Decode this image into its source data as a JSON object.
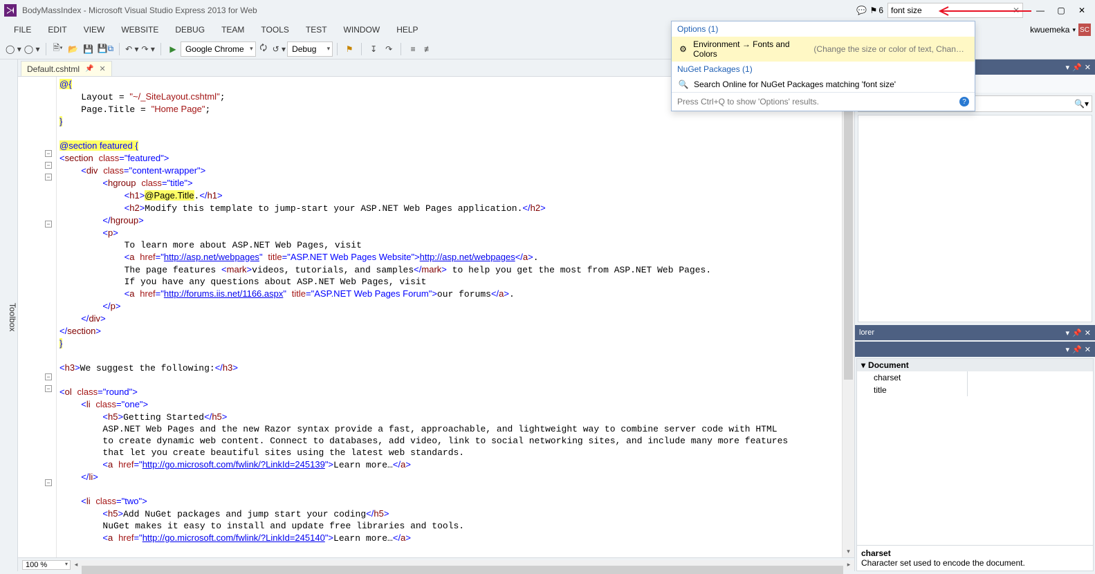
{
  "titlebar": {
    "title": "BodyMassIndex - Microsoft Visual Studio Express 2013 for Web",
    "notif_count": "6",
    "quick_launch_value": "font size"
  },
  "menubar": {
    "items": [
      "FILE",
      "EDIT",
      "VIEW",
      "WEBSITE",
      "DEBUG",
      "TEAM",
      "TOOLS",
      "TEST",
      "WINDOW",
      "HELP"
    ],
    "user_name": "kwuemeka",
    "user_initials": "SC"
  },
  "toolbar": {
    "browser": "Google Chrome",
    "config": "Debug"
  },
  "tab": {
    "name": "Default.cshtml"
  },
  "code_lines": [
    {
      "indent": 0,
      "hl": true,
      "segs": [
        {
          "c": "c-blue",
          "t": "@{"
        }
      ]
    },
    {
      "indent": 1,
      "segs": [
        {
          "t": "Layout = "
        },
        {
          "c": "c-red",
          "t": "\"~/_SiteLayout.cshtml\""
        },
        {
          "t": ";"
        }
      ]
    },
    {
      "indent": 1,
      "segs": [
        {
          "t": "Page.Title = "
        },
        {
          "c": "c-red",
          "t": "\"Home Page\""
        },
        {
          "t": ";"
        }
      ]
    },
    {
      "indent": 0,
      "hl": true,
      "segs": [
        {
          "c": "c-blue",
          "t": "}"
        }
      ]
    },
    {
      "blank": true
    },
    {
      "indent": 0,
      "hl": true,
      "segs": [
        {
          "c": "c-blue",
          "t": "@section featured {"
        }
      ]
    },
    {
      "indent": 0,
      "segs": [
        {
          "c": "c-blue",
          "t": "<"
        },
        {
          "c": "c-maroon",
          "t": "section"
        },
        {
          "t": " "
        },
        {
          "c": "c-red",
          "t": "class"
        },
        {
          "c": "c-blue",
          "t": "=\"featured\">"
        }
      ]
    },
    {
      "indent": 1,
      "segs": [
        {
          "c": "c-blue",
          "t": "<"
        },
        {
          "c": "c-maroon",
          "t": "div"
        },
        {
          "t": " "
        },
        {
          "c": "c-red",
          "t": "class"
        },
        {
          "c": "c-blue",
          "t": "=\"content-wrapper\">"
        }
      ]
    },
    {
      "indent": 2,
      "segs": [
        {
          "c": "c-blue",
          "t": "<"
        },
        {
          "c": "c-maroon",
          "t": "hgroup"
        },
        {
          "t": " "
        },
        {
          "c": "c-red",
          "t": "class"
        },
        {
          "c": "c-blue",
          "t": "=\"title\">"
        }
      ]
    },
    {
      "indent": 3,
      "segs": [
        {
          "c": "c-blue",
          "t": "<"
        },
        {
          "c": "c-maroon",
          "t": "h1"
        },
        {
          "c": "c-blue",
          "t": ">"
        },
        {
          "hl": true,
          "t": "@Page.Title"
        },
        {
          "t": "."
        },
        {
          "c": "c-blue",
          "t": "</"
        },
        {
          "c": "c-maroon",
          "t": "h1"
        },
        {
          "c": "c-blue",
          "t": ">"
        }
      ]
    },
    {
      "indent": 3,
      "segs": [
        {
          "c": "c-blue",
          "t": "<"
        },
        {
          "c": "c-maroon",
          "t": "h2"
        },
        {
          "c": "c-blue",
          "t": ">"
        },
        {
          "t": "Modify this template to jump-start your ASP.NET Web Pages application."
        },
        {
          "c": "c-blue",
          "t": "</"
        },
        {
          "c": "c-maroon",
          "t": "h2"
        },
        {
          "c": "c-blue",
          "t": ">"
        }
      ]
    },
    {
      "indent": 2,
      "segs": [
        {
          "c": "c-blue",
          "t": "</"
        },
        {
          "c": "c-maroon",
          "t": "hgroup"
        },
        {
          "c": "c-blue",
          "t": ">"
        }
      ]
    },
    {
      "indent": 2,
      "segs": [
        {
          "c": "c-blue",
          "t": "<"
        },
        {
          "c": "c-maroon",
          "t": "p"
        },
        {
          "c": "c-blue",
          "t": ">"
        }
      ]
    },
    {
      "indent": 3,
      "segs": [
        {
          "t": "To learn more about ASP.NET Web Pages, visit"
        }
      ]
    },
    {
      "indent": 3,
      "segs": [
        {
          "c": "c-blue",
          "t": "<"
        },
        {
          "c": "c-maroon",
          "t": "a"
        },
        {
          "t": " "
        },
        {
          "c": "c-red",
          "t": "href"
        },
        {
          "c": "c-blue",
          "t": "=\""
        },
        {
          "c": "c-link",
          "t": "http://asp.net/webpages"
        },
        {
          "c": "c-blue",
          "t": "\""
        },
        {
          "t": " "
        },
        {
          "c": "c-red",
          "t": "title"
        },
        {
          "c": "c-blue",
          "t": "=\"ASP.NET Web Pages Website\">"
        },
        {
          "c": "c-link",
          "t": "http://asp.net/webpages"
        },
        {
          "c": "c-blue",
          "t": "</"
        },
        {
          "c": "c-maroon",
          "t": "a"
        },
        {
          "c": "c-blue",
          "t": ">"
        },
        {
          "t": "."
        }
      ]
    },
    {
      "indent": 3,
      "segs": [
        {
          "t": "The page features "
        },
        {
          "c": "c-blue",
          "t": "<"
        },
        {
          "c": "c-maroon",
          "t": "mark"
        },
        {
          "c": "c-blue",
          "t": ">"
        },
        {
          "t": "videos, tutorials, and samples"
        },
        {
          "c": "c-blue",
          "t": "</"
        },
        {
          "c": "c-maroon",
          "t": "mark"
        },
        {
          "c": "c-blue",
          "t": ">"
        },
        {
          "t": " to help you get the most from ASP.NET Web Pages."
        }
      ]
    },
    {
      "indent": 3,
      "segs": [
        {
          "t": "If you have any questions about ASP.NET Web Pages, visit"
        }
      ]
    },
    {
      "indent": 3,
      "segs": [
        {
          "c": "c-blue",
          "t": "<"
        },
        {
          "c": "c-maroon",
          "t": "a"
        },
        {
          "t": " "
        },
        {
          "c": "c-red",
          "t": "href"
        },
        {
          "c": "c-blue",
          "t": "=\""
        },
        {
          "c": "c-link",
          "t": "http://forums.iis.net/1166.aspx"
        },
        {
          "c": "c-blue",
          "t": "\""
        },
        {
          "t": " "
        },
        {
          "c": "c-red",
          "t": "title"
        },
        {
          "c": "c-blue",
          "t": "=\"ASP.NET Web Pages Forum\">"
        },
        {
          "t": "our forums"
        },
        {
          "c": "c-blue",
          "t": "</"
        },
        {
          "c": "c-maroon",
          "t": "a"
        },
        {
          "c": "c-blue",
          "t": ">"
        },
        {
          "t": "."
        }
      ]
    },
    {
      "indent": 2,
      "segs": [
        {
          "c": "c-blue",
          "t": "</"
        },
        {
          "c": "c-maroon",
          "t": "p"
        },
        {
          "c": "c-blue",
          "t": ">"
        }
      ]
    },
    {
      "indent": 1,
      "segs": [
        {
          "c": "c-blue",
          "t": "</"
        },
        {
          "c": "c-maroon",
          "t": "div"
        },
        {
          "c": "c-blue",
          "t": ">"
        }
      ]
    },
    {
      "indent": 0,
      "segs": [
        {
          "c": "c-blue",
          "t": "</"
        },
        {
          "c": "c-maroon",
          "t": "section"
        },
        {
          "c": "c-blue",
          "t": ">"
        }
      ]
    },
    {
      "indent": 0,
      "hl": true,
      "segs": [
        {
          "c": "c-blue",
          "t": "}"
        }
      ]
    },
    {
      "blank": true
    },
    {
      "indent": 0,
      "segs": [
        {
          "c": "c-blue",
          "t": "<"
        },
        {
          "c": "c-maroon",
          "t": "h3"
        },
        {
          "c": "c-blue",
          "t": ">"
        },
        {
          "t": "We suggest the following:"
        },
        {
          "c": "c-blue",
          "t": "</"
        },
        {
          "c": "c-maroon",
          "t": "h3"
        },
        {
          "c": "c-blue",
          "t": ">"
        }
      ]
    },
    {
      "blank": true
    },
    {
      "indent": 0,
      "segs": [
        {
          "c": "c-blue",
          "t": "<"
        },
        {
          "c": "c-maroon",
          "t": "ol"
        },
        {
          "t": " "
        },
        {
          "c": "c-red",
          "t": "class"
        },
        {
          "c": "c-blue",
          "t": "=\"round\">"
        }
      ]
    },
    {
      "indent": 1,
      "segs": [
        {
          "c": "c-blue",
          "t": "<"
        },
        {
          "c": "c-maroon",
          "t": "li"
        },
        {
          "t": " "
        },
        {
          "c": "c-red",
          "t": "class"
        },
        {
          "c": "c-blue",
          "t": "=\"one\">"
        }
      ]
    },
    {
      "indent": 2,
      "segs": [
        {
          "c": "c-blue",
          "t": "<"
        },
        {
          "c": "c-maroon",
          "t": "h5"
        },
        {
          "c": "c-blue",
          "t": ">"
        },
        {
          "t": "Getting Started"
        },
        {
          "c": "c-blue",
          "t": "</"
        },
        {
          "c": "c-maroon",
          "t": "h5"
        },
        {
          "c": "c-blue",
          "t": ">"
        }
      ]
    },
    {
      "indent": 2,
      "segs": [
        {
          "t": "ASP.NET Web Pages and the new Razor syntax provide a fast, approachable, and lightweight way to combine server code with HTML"
        }
      ]
    },
    {
      "indent": 2,
      "segs": [
        {
          "t": "to create dynamic web content. Connect to databases, add video, link to social networking sites, and include many more features"
        }
      ]
    },
    {
      "indent": 2,
      "segs": [
        {
          "t": "that let you create beautiful sites using the latest web standards."
        }
      ]
    },
    {
      "indent": 2,
      "segs": [
        {
          "c": "c-blue",
          "t": "<"
        },
        {
          "c": "c-maroon",
          "t": "a"
        },
        {
          "t": " "
        },
        {
          "c": "c-red",
          "t": "href"
        },
        {
          "c": "c-blue",
          "t": "=\""
        },
        {
          "c": "c-link",
          "t": "http://go.microsoft.com/fwlink/?LinkId=245139"
        },
        {
          "c": "c-blue",
          "t": "\">"
        },
        {
          "t": "Learn more…"
        },
        {
          "c": "c-blue",
          "t": "</"
        },
        {
          "c": "c-maroon",
          "t": "a"
        },
        {
          "c": "c-blue",
          "t": ">"
        }
      ]
    },
    {
      "indent": 1,
      "segs": [
        {
          "c": "c-blue",
          "t": "</"
        },
        {
          "c": "c-maroon",
          "t": "li"
        },
        {
          "c": "c-blue",
          "t": ">"
        }
      ]
    },
    {
      "blank": true
    },
    {
      "indent": 1,
      "segs": [
        {
          "c": "c-blue",
          "t": "<"
        },
        {
          "c": "c-maroon",
          "t": "li"
        },
        {
          "t": " "
        },
        {
          "c": "c-red",
          "t": "class"
        },
        {
          "c": "c-blue",
          "t": "=\"two\">"
        }
      ]
    },
    {
      "indent": 2,
      "segs": [
        {
          "c": "c-blue",
          "t": "<"
        },
        {
          "c": "c-maroon",
          "t": "h5"
        },
        {
          "c": "c-blue",
          "t": ">"
        },
        {
          "t": "Add NuGet packages and jump start your coding"
        },
        {
          "c": "c-blue",
          "t": "</"
        },
        {
          "c": "c-maroon",
          "t": "h5"
        },
        {
          "c": "c-blue",
          "t": ">"
        }
      ]
    },
    {
      "indent": 2,
      "segs": [
        {
          "t": "NuGet makes it easy to install and update free libraries and tools."
        }
      ]
    },
    {
      "indent": 2,
      "segs": [
        {
          "c": "c-blue",
          "t": "<"
        },
        {
          "c": "c-maroon",
          "t": "a"
        },
        {
          "t": " "
        },
        {
          "c": "c-red",
          "t": "href"
        },
        {
          "c": "c-blue",
          "t": "=\""
        },
        {
          "c": "c-link",
          "t": "http://go.microsoft.com/fwlink/?LinkId=245140"
        },
        {
          "c": "c-blue",
          "t": "\">"
        },
        {
          "t": "Learn more…"
        },
        {
          "c": "c-blue",
          "t": "</"
        },
        {
          "c": "c-maroon",
          "t": "a"
        },
        {
          "c": "c-blue",
          "t": ">"
        }
      ]
    }
  ],
  "outline_markers": [
    107,
    124,
    141,
    209,
    260,
    430,
    447,
    583
  ],
  "zoom": "100 %",
  "quick_launch": {
    "cat_options": "Options (1)",
    "item_options": "Environment → Fonts and Colors",
    "item_options_desc": "(Change the size or color of text, Change t…",
    "cat_nuget": "NuGet Packages (1)",
    "item_nuget": "Search Online for NuGet Packages matching 'font size'",
    "hint": "Press Ctrl+Q to show 'Options' results."
  },
  "right": {
    "explorer_label": "lorer",
    "doc_category": "Document",
    "prop1": "charset",
    "prop2": "title",
    "help_name": "charset",
    "help_desc": "Character set used to encode the document."
  },
  "toolbox_label": "Toolbox"
}
